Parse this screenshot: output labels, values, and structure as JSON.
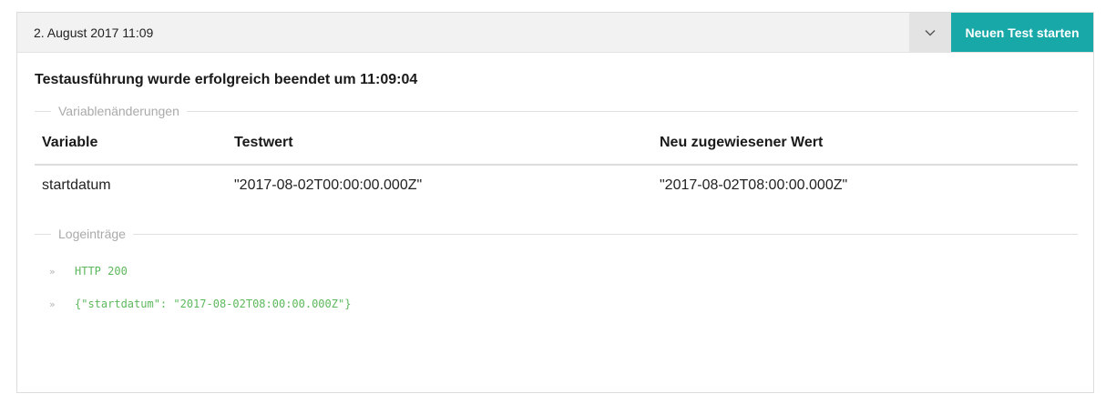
{
  "header": {
    "selected_run": "2. August 2017 11:09",
    "start_button_label": "Neuen Test starten"
  },
  "result": {
    "title": "Testausführung wurde erfolgreich beendet um 11:09:04"
  },
  "variables_section": {
    "legend": "Variablenänderungen",
    "columns": [
      "Variable",
      "Testwert",
      "Neu zugewiesener Wert"
    ],
    "rows": [
      [
        "startdatum",
        "\"2017-08-02T00:00:00.000Z\"",
        "\"2017-08-02T08:00:00.000Z\""
      ]
    ]
  },
  "logs_section": {
    "legend": "Logeinträge",
    "entries": [
      "HTTP 200",
      "{\"startdatum\": \"2017-08-02T08:00:00.000Z\"}"
    ]
  },
  "colors": {
    "accent": "#19a8a8",
    "log_text": "#5cb85c"
  },
  "icons": {
    "dropdown": "chevron-down-icon",
    "log_marker": "double-chevron-right-icon"
  }
}
